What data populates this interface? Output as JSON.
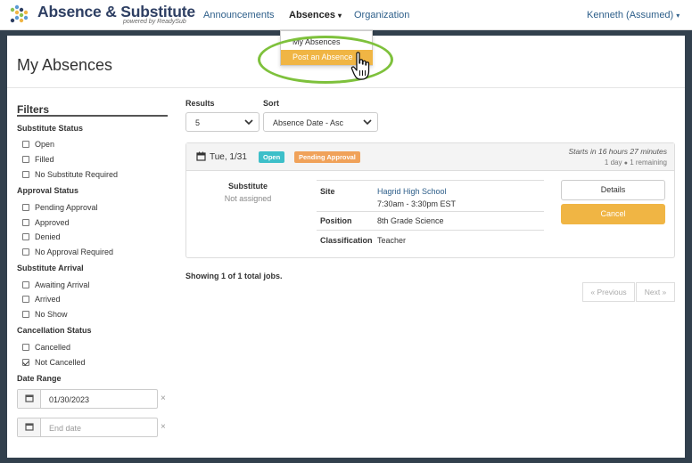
{
  "nav": {
    "brand_title": "Absence & Substitute",
    "brand_sub": "powered by ReadySub",
    "links": [
      "Announcements",
      "Absences",
      "Organization"
    ],
    "user": "Kenneth (Assumed)"
  },
  "dropdown": {
    "items": [
      "My Absences",
      "Post an Absence"
    ],
    "highlighted": "Post an Absence"
  },
  "page": {
    "title": "My Absences"
  },
  "filters": {
    "title": "Filters",
    "groups": [
      {
        "label": "Substitute Status",
        "options": [
          "Open",
          "Filled",
          "No Substitute Required"
        ]
      },
      {
        "label": "Approval Status",
        "options": [
          "Pending Approval",
          "Approved",
          "Denied",
          "No Approval Required"
        ]
      },
      {
        "label": "Substitute Arrival",
        "options": [
          "Awaiting Arrival",
          "Arrived",
          "No Show"
        ]
      },
      {
        "label": "Cancellation Status",
        "options": [
          "Cancelled",
          "Not Cancelled"
        ],
        "checked": [
          "Not Cancelled"
        ]
      }
    ],
    "date_range": {
      "label": "Date Range",
      "start_value": "01/30/2023",
      "end_placeholder": "End date",
      "clear": "×"
    }
  },
  "controls": {
    "results_label": "Results",
    "results_value": "5",
    "sort_label": "Sort",
    "sort_value": "Absence Date - Asc"
  },
  "absence": {
    "date": "Tue, 1/31",
    "badge_open": "Open",
    "badge_pending": "Pending Approval",
    "starts_in": "Starts in 16 hours 27 minutes",
    "duration": "1 day",
    "remaining": "1 remaining",
    "substitute_label": "Substitute",
    "substitute_value": "Not assigned",
    "site_label": "Site",
    "site_value": "Hagrid High School",
    "site_time": "7:30am - 3:30pm EST",
    "position_label": "Position",
    "position_value": "8th Grade Science",
    "classification_label": "Classification",
    "classification_value": "Teacher",
    "details_button": "Details",
    "cancel_button": "Cancel"
  },
  "pagination": {
    "summary": "Showing 1 of 1 total jobs.",
    "previous": "« Previous",
    "next": "Next »"
  },
  "colors": {
    "accent": "#f0b544",
    "open_badge": "#3dbfc9",
    "pending_badge": "#f0a25a",
    "brand": "#2e3f63",
    "link": "#2e5f8a",
    "highlight_ring": "#7ec13c"
  }
}
